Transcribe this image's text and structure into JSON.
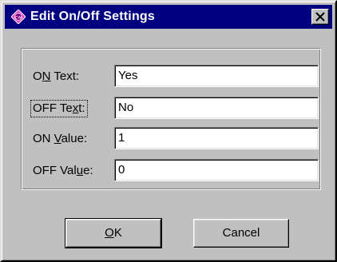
{
  "window": {
    "title": "Edit On/Off Settings",
    "app_icon": "cw-app-icon",
    "close_icon": "close-x-icon"
  },
  "fields": [
    {
      "label_pre": "O",
      "label_accel": "N",
      "label_post": " Text:",
      "value": "Yes"
    },
    {
      "label_pre": "OFF Te",
      "label_accel": "x",
      "label_post": "t:",
      "value": "No"
    },
    {
      "label_pre": "ON ",
      "label_accel": "V",
      "label_post": "alue:",
      "value": "1"
    },
    {
      "label_pre": "OFF Val",
      "label_accel": "u",
      "label_post": "e:",
      "value": "0"
    }
  ],
  "buttons": {
    "ok": {
      "accel": "O",
      "rest": "K"
    },
    "cancel": {
      "label": "Cancel"
    }
  },
  "colors": {
    "titlebar": "#000080",
    "face": "#c0c0c0",
    "field": "#ffffff"
  }
}
